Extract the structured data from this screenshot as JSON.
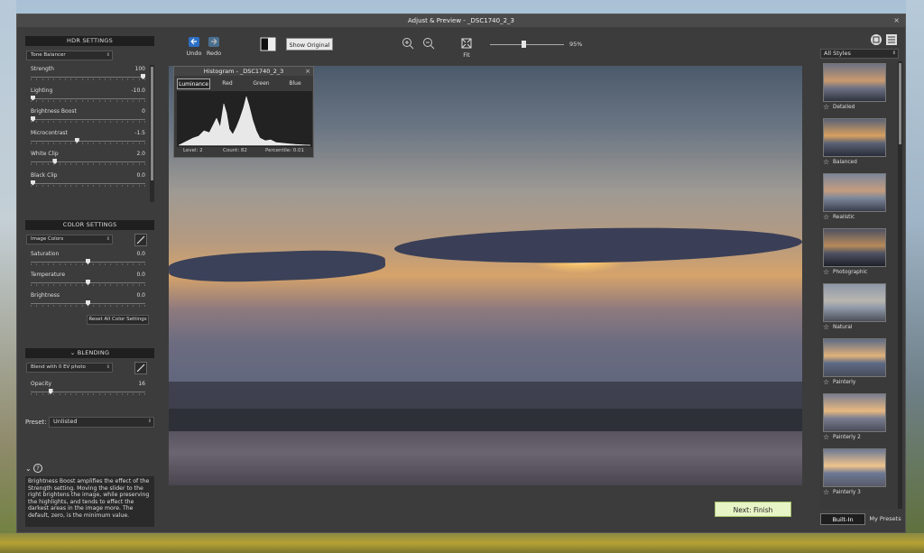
{
  "window": {
    "title": "Adjust & Preview - _DSC1740_2_3",
    "close_glyph": "×"
  },
  "hdr": {
    "header": "HDR SETTINGS",
    "preset_dropdown": "Tone Balancer",
    "sliders": [
      {
        "label": "Strength",
        "value": "100",
        "level": 1.0
      },
      {
        "label": "Lighting",
        "value": "-10.0",
        "level": 0.0
      },
      {
        "label": "Brightness Boost",
        "value": "0",
        "level": 0.0
      },
      {
        "label": "Microcontrast",
        "value": "-1.5",
        "level": 0.4
      },
      {
        "label": "White Clip",
        "value": "2.0",
        "level": 0.2
      },
      {
        "label": "Black Clip",
        "value": "0.0",
        "level": 0.0
      }
    ]
  },
  "color": {
    "header": "COLOR SETTINGS",
    "dropdown": "Image Colors",
    "sliders": [
      {
        "label": "Saturation",
        "value": "0.0",
        "level": 0.5
      },
      {
        "label": "Temperature",
        "value": "0.0",
        "level": 0.5
      },
      {
        "label": "Brightness",
        "value": "0.0",
        "level": 0.5
      }
    ],
    "reset_label": "Reset All Color Settings"
  },
  "blending": {
    "header": "BLENDING",
    "dropdown": "Blend with 0 EV photo",
    "slider": {
      "label": "Opacity",
      "value": "16",
      "level": 0.16
    }
  },
  "preset": {
    "label": "Preset:",
    "value": "Unlisted"
  },
  "help": {
    "text": "Brightness Boost amplifies the effect of the Strength setting. Moving the slider to the right brightens the image, while preserving the highlights, and tends to effect the darkest areas in the image more. The default, zero, is the minimum value."
  },
  "toolbar": {
    "undo": "Undo",
    "redo": "Redo",
    "show_original": "Show Original",
    "fit": "Fit",
    "zoom_pct": "95%",
    "zoom_level": 0.45
  },
  "histogram": {
    "title": "Histogram - _DSC1740_2_3",
    "tabs": [
      "Luminance",
      "Red",
      "Green",
      "Blue"
    ],
    "active_tab": "Luminance",
    "level": "Level: 2",
    "count": "Count: 82",
    "percentile": "Percentile: 0.01"
  },
  "styles": {
    "dropdown": "All Styles",
    "items": [
      "Detailed",
      "Balanced",
      "Realistic",
      "Photographic",
      "Natural",
      "Painterly",
      "Painterly 2",
      "Painterly 3"
    ],
    "tab_builtin": "Built-In",
    "tab_mypresets": "My Presets"
  },
  "actions": {
    "finish": "Next: Finish"
  }
}
